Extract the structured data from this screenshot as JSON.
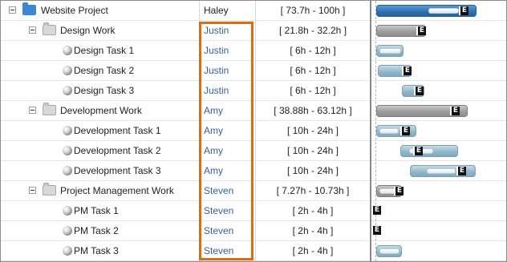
{
  "colors": {
    "highlight": "#de6b10",
    "resource_text": "#3a5f9a",
    "root_bar": "#2f6fb0",
    "summary_bar": "#9b9b9b",
    "task_bar": "#8fb6c8"
  },
  "icons": {
    "root": "folder-blue-icon",
    "summary": "folder-gray-icon",
    "task": "task-ball-icon",
    "toggle": "collapse-icon",
    "estimate_marker": "estimate-e-icon"
  },
  "rows": [
    {
      "name": "Website Project",
      "resource": "Haley",
      "estimate": "[ 73.7h - 100h ]",
      "level": 0,
      "type": "root"
    },
    {
      "name": "Design Work",
      "resource": "Justin",
      "estimate": "[ 21.8h - 32.2h ]",
      "level": 1,
      "type": "summary"
    },
    {
      "name": "Design Task 1",
      "resource": "Justin",
      "estimate": "[ 6h - 12h ]",
      "level": 2,
      "type": "task"
    },
    {
      "name": "Design Task 2",
      "resource": "Justin",
      "estimate": "[ 6h - 12h ]",
      "level": 2,
      "type": "task"
    },
    {
      "name": "Design Task 3",
      "resource": "Justin",
      "estimate": "[ 6h - 12h ]",
      "level": 2,
      "type": "task"
    },
    {
      "name": "Development Work",
      "resource": "Amy",
      "estimate": "[ 38.88h - 63.12h ]",
      "level": 1,
      "type": "summary"
    },
    {
      "name": "Development Task 1",
      "resource": "Amy",
      "estimate": "[ 10h - 24h ]",
      "level": 2,
      "type": "task"
    },
    {
      "name": "Development Task 2",
      "resource": "Amy",
      "estimate": "[ 10h - 24h ]",
      "level": 2,
      "type": "task"
    },
    {
      "name": "Development Task 3",
      "resource": "Amy",
      "estimate": "[ 10h - 24h ]",
      "level": 2,
      "type": "task"
    },
    {
      "name": "Project Management Work",
      "resource": "Steven",
      "estimate": "[ 7.27h - 10.73h ]",
      "level": 1,
      "type": "summary"
    },
    {
      "name": "PM Task 1",
      "resource": "Steven",
      "estimate": "[ 2h - 4h ]",
      "level": 2,
      "type": "task"
    },
    {
      "name": "PM Task 2",
      "resource": "Steven",
      "estimate": "[ 2h - 4h ]",
      "level": 2,
      "type": "task"
    },
    {
      "name": "PM Task 3",
      "resource": "Steven",
      "estimate": "[ 2h - 4h ]",
      "level": 2,
      "type": "task"
    }
  ]
}
